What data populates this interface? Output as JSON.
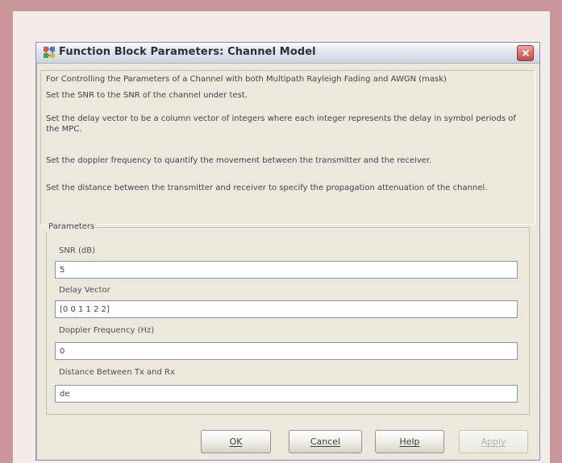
{
  "window": {
    "title": "Function Block Parameters: Channel Model",
    "icons": {
      "app": "simulink-block-icon",
      "close": "close-icon"
    }
  },
  "description": {
    "heading": "For Controlling the Parameters of a Channel with both Multipath Rayleigh Fading and AWGN (mask)",
    "lines": [
      "Set the SNR to the SNR of the channel under test.",
      "Set the delay vector to be a column vector of integers where each integer represents the delay in symbol periods of the MPC.",
      "Set the doppler frequency to quantify the movement between the transmitter and the receiver.",
      "Set the distance between the transmitter and receiver to specify the propagation attenuation of the channel."
    ]
  },
  "parameters": {
    "group_label": "Parameters",
    "fields": [
      {
        "label": "SNR (dB)",
        "value": "5"
      },
      {
        "label": "Delay Vector",
        "value": "[0 0 1 1 2 2]"
      },
      {
        "label": "Doppler Frequency (Hz)",
        "value": "0"
      },
      {
        "label": "Distance Between Tx and Rx",
        "value": "de"
      }
    ]
  },
  "buttons": {
    "ok": "OK",
    "cancel": "Cancel",
    "help": "Help",
    "apply": "Apply"
  },
  "colors": {
    "frame": "#c9969a",
    "dialog": "#ece9dc",
    "close_button": "#d86d64"
  }
}
